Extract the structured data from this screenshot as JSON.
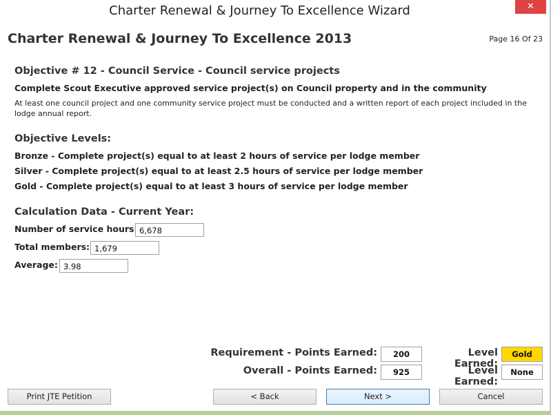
{
  "window": {
    "title": "Charter Renewal & Journey To Excellence Wizard",
    "close_glyph": "✕"
  },
  "header": {
    "title": "Charter Renewal & Journey To Excellence 2013",
    "page_indicator": "Page 16 Of 23"
  },
  "objective": {
    "title": "Objective # 12  - Council Service - Council service projects",
    "subtitle": "Complete Scout Executive approved service project(s) on Council property and in the community",
    "description": "At least one council project and one community service project must be conducted and a written report of each project included in the lodge annual report."
  },
  "levels": {
    "heading": "Objective Levels:",
    "items": [
      "Bronze - Complete project(s) equal to at least 2 hours of service per lodge member",
      "Silver - Complete project(s) equal to at least 2.5 hours of service per lodge member",
      "Gold - Complete project(s) equal to at least 3 hours of service per lodge member"
    ]
  },
  "calc": {
    "heading": "Calculation Data - Current Year:",
    "service_hours_label": "Number of service hours:",
    "service_hours_value": "6,678",
    "total_members_label": "Total members:",
    "total_members_value": "1,679",
    "average_label": "Average:",
    "average_value": "3.98"
  },
  "points": {
    "requirement_label": "Requirement - Points Earned:",
    "requirement_value": "200",
    "requirement_level_label": "Level Earned:",
    "requirement_level_value": "Gold",
    "overall_label": "Overall - Points Earned:",
    "overall_value": "925",
    "overall_level_label": "Level Earned:",
    "overall_level_value": "None"
  },
  "buttons": {
    "print": "Print JTE Petition",
    "back": "< Back",
    "next": "Next >",
    "cancel": "Cancel"
  },
  "colors": {
    "gold_badge": "#ffd700",
    "close_button": "#e04343",
    "footer_strip": "#b9cf9a"
  }
}
